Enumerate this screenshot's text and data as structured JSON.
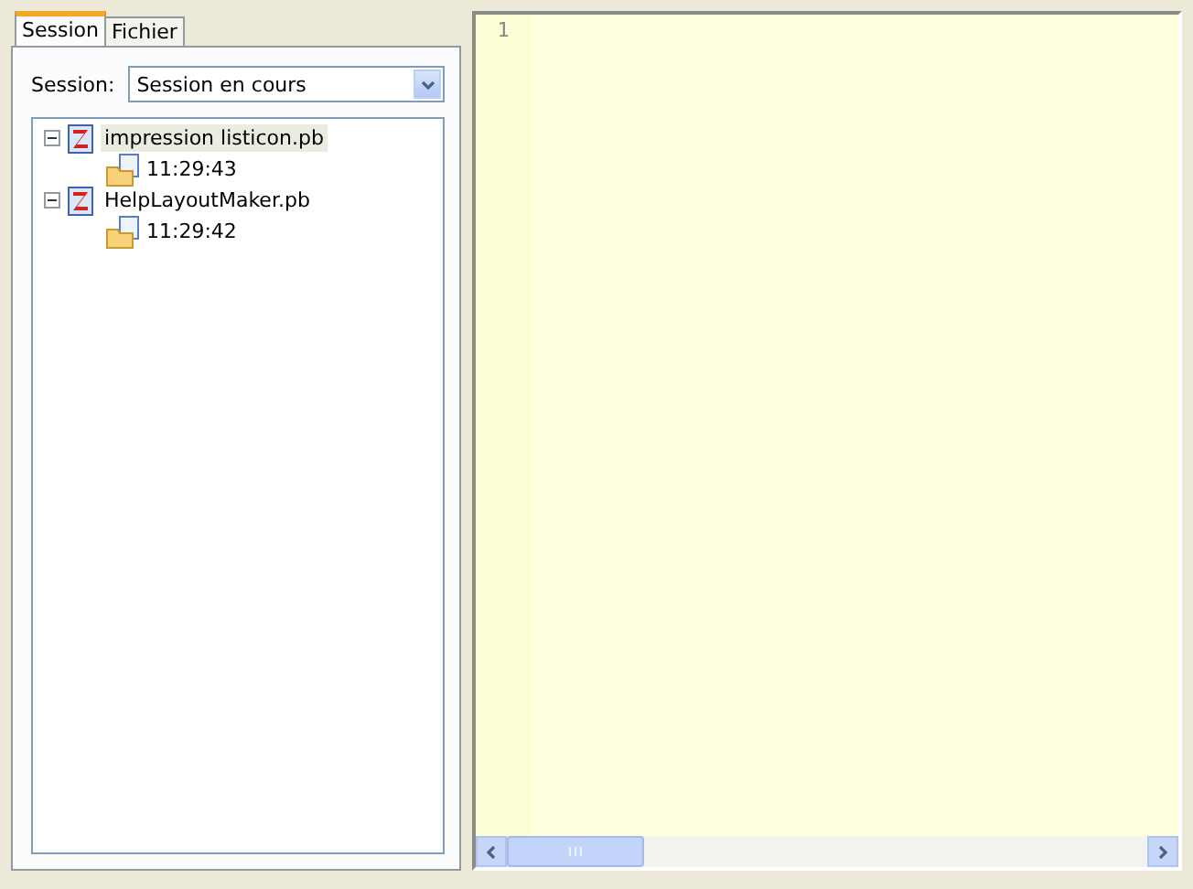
{
  "tabs": [
    {
      "label": "Session",
      "selected": true
    },
    {
      "label": "Fichier",
      "selected": false
    }
  ],
  "session": {
    "label": "Session:",
    "value": "Session en cours"
  },
  "tree": [
    {
      "label": "impression listicon.pb",
      "selected": true,
      "expanded": true,
      "children": [
        {
          "label": "11:29:43"
        }
      ]
    },
    {
      "label": "HelpLayoutMaker.pb",
      "selected": false,
      "expanded": true,
      "children": [
        {
          "label": "11:29:42"
        }
      ]
    }
  ],
  "editor": {
    "line_numbers": [
      "1"
    ]
  }
}
